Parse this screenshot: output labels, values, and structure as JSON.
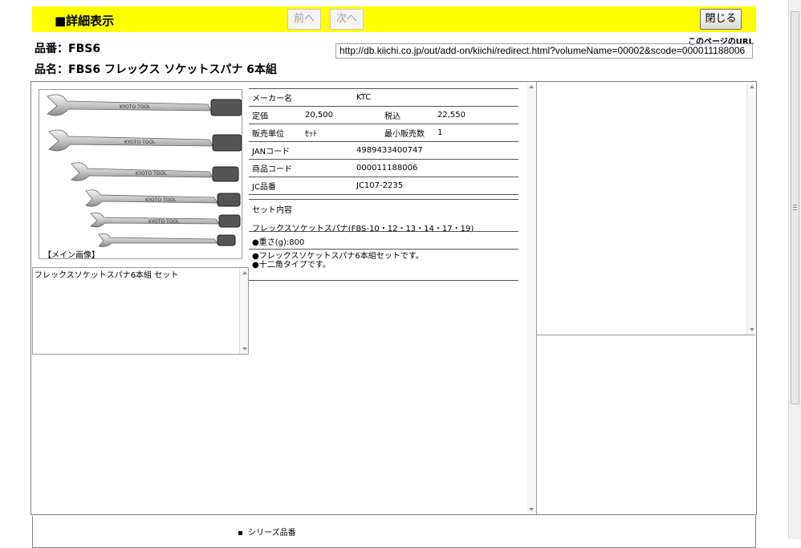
{
  "header": {
    "title": "■詳細表示",
    "prev_label": "前へ",
    "next_label": "次へ",
    "close_label": "閉じる"
  },
  "page_url": {
    "label": "このページのURL",
    "value": "http://db.kiichi.co.jp/out/add-on/kiichi/redirect.html?volumeName=00002&scode=000011188006"
  },
  "product": {
    "part_no_line": "品番：FBS6",
    "name_line": "品名：FBS6 フレックス ソケットスパナ 6本組"
  },
  "image": {
    "caption": "【メイン画像】",
    "brand_text": "KYOTO TOOL"
  },
  "description": "フレックスソケットスパナ6本組 セット",
  "info": {
    "maker_label": "メーカー名",
    "maker_value": "KTC",
    "list_price_label": "定価",
    "list_price_value": "20,500",
    "tax_incl_label": "税込",
    "tax_incl_value": "22,550",
    "sales_unit_label": "販売単位",
    "sales_unit_value": "ｾｯﾄ",
    "min_qty_label": "最小販売数",
    "min_qty_value": "1",
    "jan_label": "JANコード",
    "jan_value": "4989433400747",
    "product_code_label": "商品コード",
    "product_code_value": "000011188006",
    "jc_label": "JC品番",
    "jc_value": "JC107-2235"
  },
  "set_contents": {
    "label": "セット内容",
    "value": "フレックスソケットスパナ(FBS-10・12・13・14・17・19)"
  },
  "weight": "●重さ(g):800",
  "features": [
    "●フレックスソケットスパナ6本組セットです。",
    "●十二角タイプです。"
  ],
  "bottom": {
    "series_label": "シリーズ品番"
  }
}
